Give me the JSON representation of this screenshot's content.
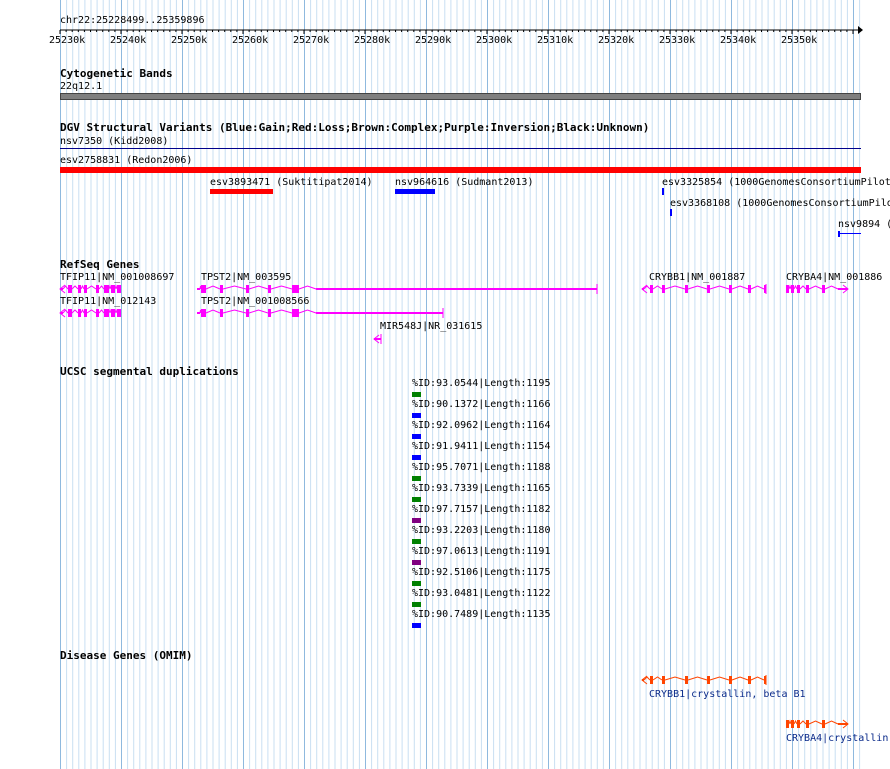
{
  "ruler": {
    "location": "chr22:25228499..25359896",
    "ticks": [
      "25230k",
      "25240k",
      "25250k",
      "25260k",
      "25270k",
      "25280k",
      "25290k",
      "25300k",
      "25310k",
      "25320k",
      "25330k",
      "25340k",
      "25350k"
    ]
  },
  "tracks": {
    "cyto": {
      "title": "Cytogenetic Bands",
      "band": "22q12.1"
    },
    "dgv": {
      "title": "DGV Structural Variants (Blue:Gain;Red:Loss;Brown:Complex;Purple:Inversion;Black:Unknown)",
      "items": [
        {
          "label": "nsv7350 (Kidd2008)",
          "color": "#00008b"
        },
        {
          "label": "esv2758831 (Redon2006)",
          "color": "#ff0000"
        },
        {
          "label": "esv3893471 (Suktitipat2014)",
          "color": "#ff0000"
        },
        {
          "label": "nsv964616 (Sudmant2013)",
          "color": "#0000ff"
        },
        {
          "label": "esv3325854 (1000GenomesConsortiumPilot",
          "color": "#0000ff"
        },
        {
          "label": "esv3368108 (1000GenomesConsortiumPilo",
          "color": "#0000ff"
        },
        {
          "label": "nsv9894 (",
          "color": "#0000ff"
        }
      ]
    },
    "refseq": {
      "title": "RefSeq Genes",
      "color": "#ff00ff",
      "genes": [
        {
          "label": "TFIP11|NM_001008697"
        },
        {
          "label": "TPST2|NM_003595"
        },
        {
          "label": "CRYBB1|NM_001887"
        },
        {
          "label": "CRYBA4|NM_001886"
        },
        {
          "label": "TFIP11|NM_012143"
        },
        {
          "label": "TPST2|NM_001008566"
        },
        {
          "label": "MIR548J|NR_031615"
        }
      ]
    },
    "segdup": {
      "title": "UCSC segmental duplications",
      "items": [
        {
          "label": "%ID:93.0544|Length:1195",
          "color": "#008000"
        },
        {
          "label": "%ID:90.1372|Length:1166",
          "color": "#0000ff"
        },
        {
          "label": "%ID:92.0962|Length:1164",
          "color": "#0000ff"
        },
        {
          "label": "%ID:91.9411|Length:1154",
          "color": "#0000ff"
        },
        {
          "label": "%ID:95.7071|Length:1188",
          "color": "#008000"
        },
        {
          "label": "%ID:93.7339|Length:1165",
          "color": "#008000"
        },
        {
          "label": "%ID:97.7157|Length:1182",
          "color": "#800080"
        },
        {
          "label": "%ID:93.2203|Length:1180",
          "color": "#008000"
        },
        {
          "label": "%ID:97.0613|Length:1191",
          "color": "#800080"
        },
        {
          "label": "%ID:92.5106|Length:1175",
          "color": "#008000"
        },
        {
          "label": "%ID:93.0481|Length:1122",
          "color": "#008000"
        },
        {
          "label": "%ID:90.7489|Length:1135",
          "color": "#0000ff"
        }
      ]
    },
    "omim": {
      "title": "Disease Genes (OMIM)",
      "color": "#ff4500",
      "label_color": "#0a2a8a",
      "genes": [
        {
          "label": "CRYBB1|crystallin, beta B1"
        },
        {
          "label": "CRYBA4|crystallin"
        }
      ]
    }
  }
}
